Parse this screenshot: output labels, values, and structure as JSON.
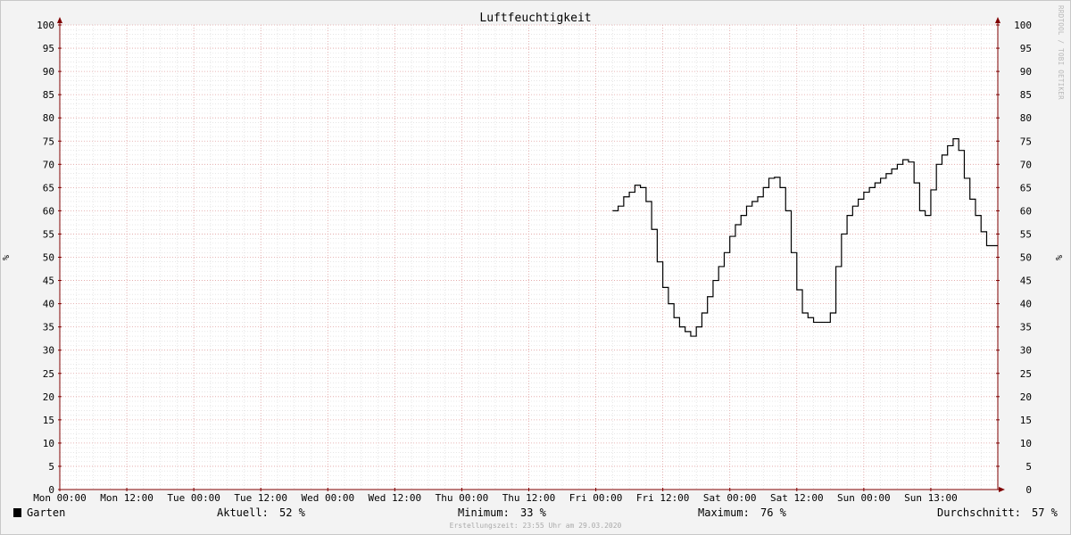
{
  "chart_data": {
    "type": "line",
    "title": "Luftfeuchtigkeit",
    "ylabel": "%",
    "ylim": [
      0,
      100
    ],
    "yticks": [
      0,
      5,
      10,
      15,
      20,
      25,
      30,
      35,
      40,
      45,
      50,
      55,
      60,
      65,
      70,
      75,
      80,
      85,
      90,
      95,
      100
    ],
    "x_tick_labels": [
      "Mon 00:00",
      "Mon 12:00",
      "Tue 00:00",
      "Tue 12:00",
      "Wed 00:00",
      "Wed 12:00",
      "Thu 00:00",
      "Thu 12:00",
      "Fri 00:00",
      "Fri 12:00",
      "Sat 00:00",
      "Sat 12:00",
      "Sun 00:00",
      "Sun 13:00"
    ],
    "x_unit": "hours since Mon 00:00",
    "xlim": [
      0,
      168
    ],
    "grid": true,
    "series": [
      {
        "name": "Garten",
        "color": "#000000",
        "x": [
          99,
          100,
          101,
          102,
          103,
          104,
          105,
          106,
          107,
          108,
          109,
          110,
          111,
          112,
          113,
          114,
          115,
          116,
          117,
          118,
          119,
          120,
          121,
          122,
          123,
          124,
          125,
          126,
          127,
          128,
          129,
          130,
          131,
          132,
          133,
          134,
          135,
          136,
          137,
          138,
          139,
          140,
          141,
          142,
          143,
          144,
          145,
          146,
          147,
          148,
          149,
          150,
          151,
          152,
          153,
          154,
          155,
          156,
          157,
          158,
          159,
          160,
          161,
          162,
          163,
          164,
          165,
          166,
          167
        ],
        "values": [
          60,
          61,
          63,
          64,
          65.5,
          65,
          62,
          56,
          49,
          43.5,
          40,
          37,
          35,
          34,
          33,
          35,
          38,
          41.5,
          45,
          48,
          51,
          54.5,
          57,
          59,
          61,
          62,
          63,
          65,
          67,
          67.2,
          65,
          60,
          51,
          43,
          38,
          37,
          36,
          36,
          36,
          38,
          48,
          55,
          59,
          61,
          62.5,
          64,
          65,
          66,
          67,
          68,
          69,
          70,
          71,
          70.5,
          66,
          60,
          59,
          64.5,
          70,
          72,
          74,
          75.5,
          73,
          67,
          62.5,
          59,
          55.5,
          52.5,
          52.5
        ]
      }
    ]
  },
  "legend": {
    "series_name": "Garten",
    "aktuell_label": "Aktuell:",
    "aktuell_value": "52 %",
    "minimum_label": "Minimum:",
    "minimum_value": "33 %",
    "maximum_label": "Maximum:",
    "maximum_value": "76 %",
    "durchschnitt_label": "Durchschnitt:",
    "durchschnitt_value": "57 %"
  },
  "footer_text": "Erstellungszeit: 23:55 Uhr am 29.03.2020",
  "watermark_text": "RRDTOOL / TOBI OETIKER",
  "colors": {
    "background": "#f3f3f3",
    "plot_background": "#ffffff",
    "major_grid": "#e0a0a0",
    "minor_grid": "#d8d8d8",
    "axis": "#800000",
    "line": "#000000"
  }
}
